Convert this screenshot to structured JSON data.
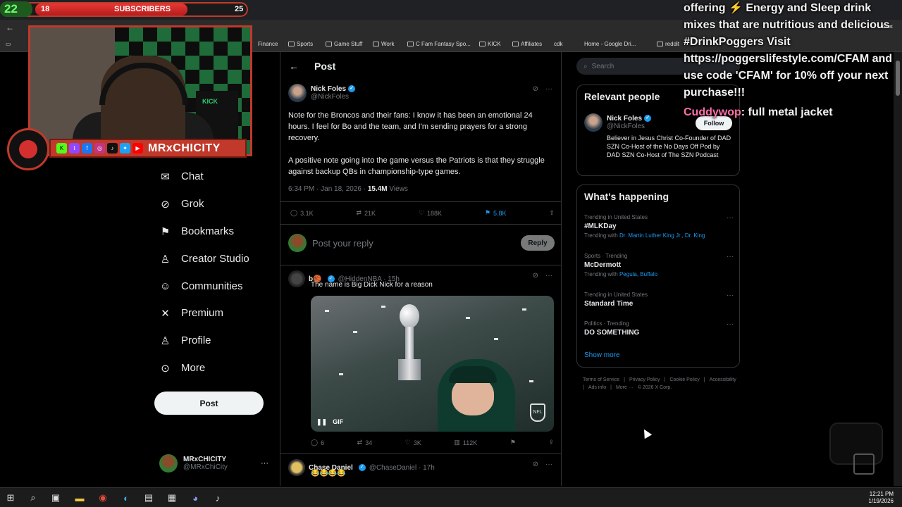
{
  "overlay": {
    "sub_count_left": "22",
    "sub_current": "18",
    "sub_label": "SUBSCRIBERS",
    "sub_goal": "25",
    "streamer_name": "MRxCHICITY",
    "cam_sign": "KICK",
    "chat_lines": [
      "offering ⚡ Energy and Sleep drink mixes that are nutritious and delicious #DrinkPoggers Visit https://poggerslifestyle.com/CFAM and use code 'CFAM' for 10% off your next purchase!!!"
    ],
    "chat_user": "Cuddywop",
    "chat_user_msg": ": full metal jacket",
    "chat_label": "Chat"
  },
  "bookmarks": [
    "Finance",
    "Sports",
    "Game Stuff",
    "Work",
    "C Fam Fantasy Spo...",
    "KICK",
    "Affiliates",
    "cdk",
    "Home - Google Dri...",
    "reddit"
  ],
  "left_nav": {
    "items": [
      {
        "label": "Chat",
        "icon": "mail-icon"
      },
      {
        "label": "Grok",
        "icon": "grok-icon"
      },
      {
        "label": "Bookmarks",
        "icon": "bookmark-icon"
      },
      {
        "label": "Creator Studio",
        "icon": "creator-icon"
      },
      {
        "label": "Communities",
        "icon": "communities-icon"
      },
      {
        "label": "Premium",
        "icon": "x-icon"
      },
      {
        "label": "Profile",
        "icon": "profile-icon"
      },
      {
        "label": "More",
        "icon": "more-icon"
      }
    ],
    "post_button": "Post",
    "account_name": "MRxCHICITY",
    "account_handle": "@MRxChiCity"
  },
  "main": {
    "header": "Post",
    "tweet": {
      "name": "Nick Foles",
      "handle": "@NickFoles",
      "body_1": "Note for the Broncos and their fans: I know it has been an emotional 24 hours. I feel for Bo and the team, and I'm sending prayers for a strong recovery.",
      "body_2": "A positive note going into the game versus the Patriots is that they struggle against backup QBs in championship-type games.",
      "time": "6:34 PM · Jan 18, 2026 · ",
      "views": "15.4M",
      "views_label": " Views",
      "replies": "3.1K",
      "reposts": "21K",
      "likes": "188K",
      "bookmarks": "5.8K"
    },
    "reply_placeholder": "Post your reply",
    "reply_button": "Reply",
    "replies": [
      {
        "name": "b🏀",
        "handle": "@HiddenNBA · 15h",
        "text": "The name is Big Dick Nick for a reason",
        "gif_label": "GIF",
        "replies": "6",
        "reposts": "34",
        "likes": "3K",
        "views": "112K"
      },
      {
        "name": "Chase Daniel",
        "handle": "@ChaseDaniel · 17h",
        "text": "😂😂😂😂"
      }
    ]
  },
  "right": {
    "search_placeholder": "Search",
    "relevant_title": "Relevant people",
    "person_name": "Nick Foles",
    "person_handle": "@NickFoles",
    "follow_label": "Follow",
    "person_bio": "Believer in Jesus Christ Co-Founder of DAD SZN Co-Host of the No Days Off Pod by DAD SZN Co-Host of The SZN Podcast",
    "happening_title": "What's happening",
    "trends": [
      {
        "context": "Trending in United States",
        "topic": "#MLKDay",
        "with_prefix": "Trending with ",
        "with": "Dr. Martin Luther King Jr., Dr. King"
      },
      {
        "context": "Sports · Trending",
        "topic": "McDermott",
        "with_prefix": "Trending with ",
        "with": "Pegula, Buffalo"
      },
      {
        "context": "Trending in United States",
        "topic": "Standard Time",
        "with_prefix": "",
        "with": ""
      },
      {
        "context": "Politics · Trending",
        "topic": "DO SOMETHING",
        "with_prefix": "",
        "with": ""
      }
    ],
    "show_more": "Show more",
    "footer": [
      "Terms of Service",
      "|",
      "Privacy Policy",
      "|",
      "Cookie Policy",
      "|",
      "Accessibility",
      "|",
      "Ads info",
      "|",
      "More ···",
      "© 2026 X Corp."
    ]
  },
  "taskbar": {
    "time": "12:21 PM",
    "date": "1/19/2026"
  },
  "colors": {
    "accent": "#1d9bf0",
    "overlay_red": "#c0392b",
    "background": "#000000"
  }
}
